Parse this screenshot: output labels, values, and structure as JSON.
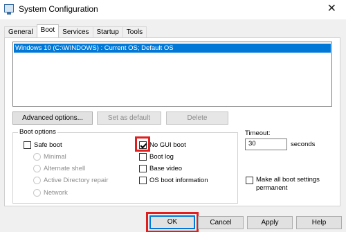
{
  "window": {
    "title": "System Configuration",
    "close_glyph": "✕",
    "icon": "msconfig-icon"
  },
  "tabs": [
    {
      "label": "General"
    },
    {
      "label": "Boot",
      "active": true
    },
    {
      "label": "Services"
    },
    {
      "label": "Startup"
    },
    {
      "label": "Tools"
    }
  ],
  "os_list": {
    "items": [
      "Windows 10 (C:\\WINDOWS) : Current OS; Default OS"
    ],
    "selected": 0
  },
  "buttons": {
    "advanced": "Advanced options...",
    "set_default": "Set as default",
    "delete": "Delete"
  },
  "boot_options": {
    "title": "Boot options",
    "safe_boot": {
      "label": "Safe boot",
      "checked": false
    },
    "minimal": "Minimal",
    "alternate_shell": "Alternate shell",
    "ad_repair": "Active Directory repair",
    "network": "Network",
    "no_gui_boot": {
      "label": "No GUI boot",
      "checked": true
    },
    "boot_log": {
      "label": "Boot log",
      "checked": false
    },
    "base_video": {
      "label": "Base video",
      "checked": false
    },
    "os_boot_info": {
      "label": "OS boot information",
      "checked": false
    }
  },
  "timeout": {
    "label": "Timeout:",
    "value": "30",
    "unit": "seconds"
  },
  "make_permanent": {
    "line1": "Make all boot settings",
    "line2": "permanent",
    "checked": false
  },
  "footer": {
    "ok": "OK",
    "cancel": "Cancel",
    "apply": "Apply",
    "help": "Help"
  },
  "colors": {
    "selection": "#0078d7",
    "highlight_box": "#e02020"
  }
}
